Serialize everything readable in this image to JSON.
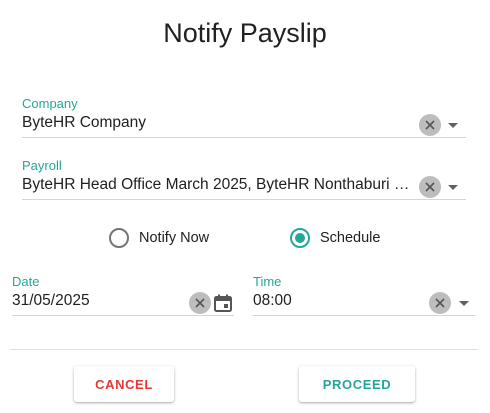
{
  "dialog": {
    "title": "Notify Payslip"
  },
  "company": {
    "label": "Company",
    "value": "ByteHR Company"
  },
  "payroll": {
    "label": "Payroll",
    "value": "ByteHR  Head Office March 2025, ByteHR Nonthaburi M..."
  },
  "notify_mode": {
    "options": [
      {
        "label": "Notify Now",
        "checked": false
      },
      {
        "label": "Schedule",
        "checked": true
      }
    ]
  },
  "date": {
    "label": "Date",
    "value": "31/05/2025"
  },
  "time": {
    "label": "Time",
    "value": "08:00"
  },
  "actions": {
    "cancel_label": "CANCEL",
    "proceed_label": "PROCEED"
  },
  "colors": {
    "accent": "#26a69a",
    "cancel": "#e53935",
    "label": "#26a69a"
  },
  "icons": {
    "clear": "close-circle-icon",
    "dropdown": "caret-down-icon",
    "calendar": "calendar-icon"
  }
}
